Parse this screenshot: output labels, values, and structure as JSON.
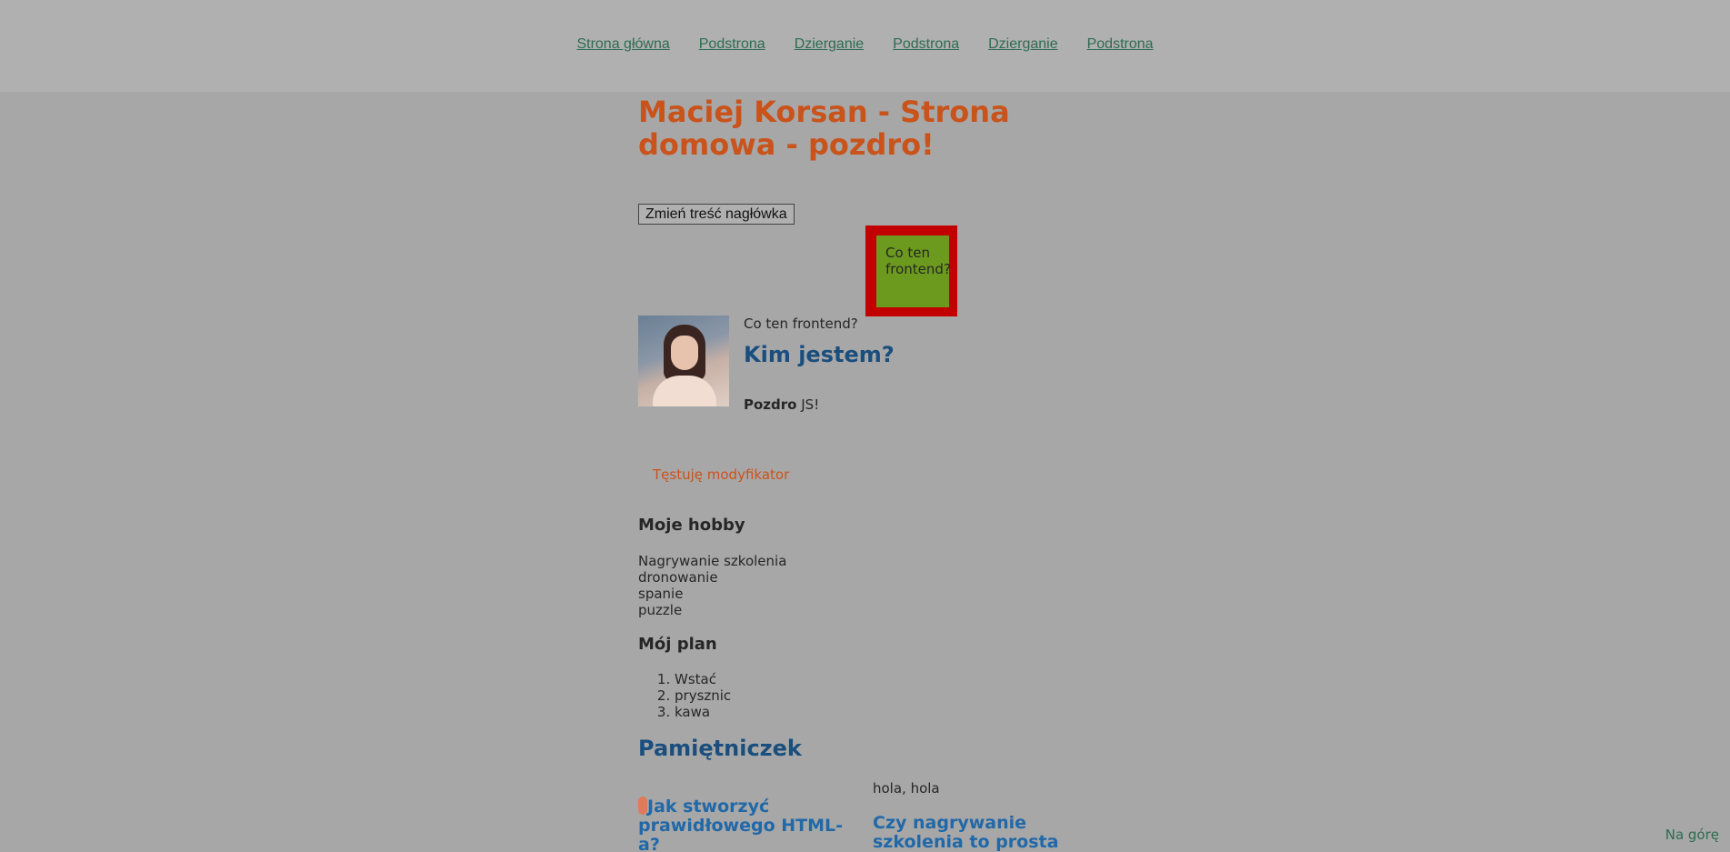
{
  "nav": {
    "items": [
      {
        "label": "Strona główna"
      },
      {
        "label": "Podstrona"
      },
      {
        "label": "Dzierganie"
      },
      {
        "label": "Podstrona"
      },
      {
        "label": "Dzierganie"
      },
      {
        "label": "Podstrona"
      }
    ]
  },
  "header": {
    "title": "Maciej Korsan - Strona domowa - pozdro!",
    "change_button": "Zmień treść nagłówka"
  },
  "box": {
    "text": "Co ten frontend?"
  },
  "about": {
    "intro": "Co ten frontend?",
    "heading": "Kim jestem?",
    "greeting_bold": "Pozdro",
    "greeting_rest": " JS!"
  },
  "modifier_text": "Tęstuję modyfikator",
  "hobby": {
    "heading": "Moje hobby",
    "items": [
      "Nagrywanie szkolenia",
      "dronowanie",
      "spanie",
      "puzzle"
    ]
  },
  "plan": {
    "heading": "Mój plan",
    "items": [
      "Wstać",
      "prysznic",
      "kawa"
    ]
  },
  "diary": {
    "heading": "Pamiętniczek",
    "post1_title": "Jak stworzyć prawidłowego HTML-a?",
    "side_text": "hola, hola",
    "post2_title": "Czy nagrywanie szkolenia to prosta sprawa?"
  },
  "to_top": "Na górę",
  "colors": {
    "accent_orange": "#c9531b",
    "heading_blue": "#1a4e7e",
    "link_green": "#2e6b53",
    "box_red": "#c30000",
    "box_green": "#6c9a1e"
  }
}
